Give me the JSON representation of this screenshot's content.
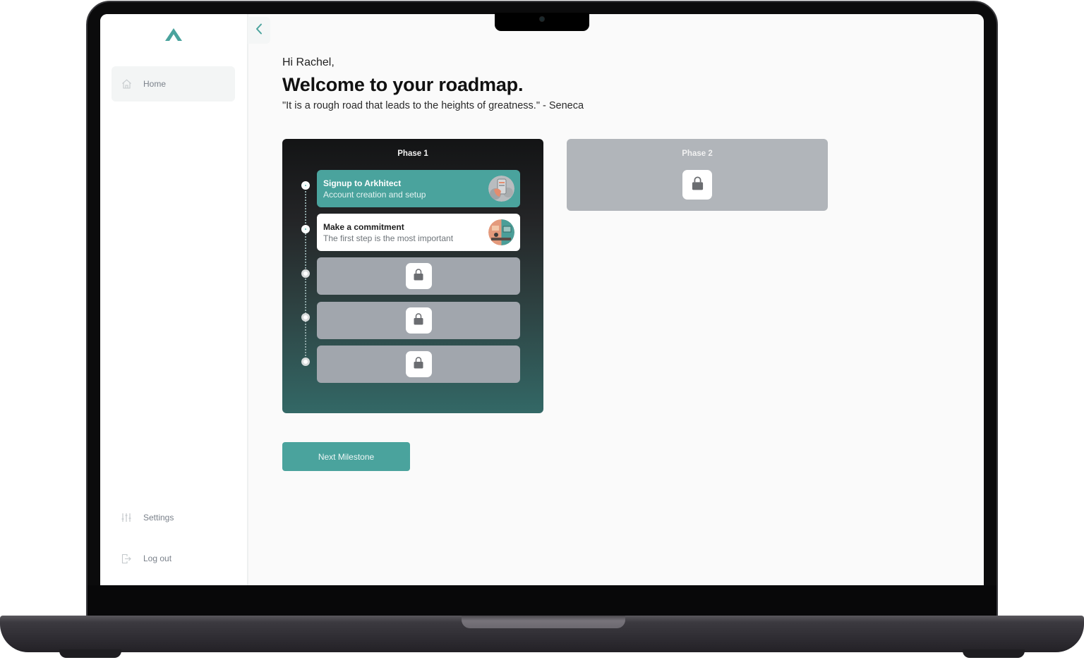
{
  "app": {
    "brand_color": "#4aa39d",
    "logo_icon": "chevron-up-logo"
  },
  "sidebar": {
    "items": [
      {
        "label": "Home",
        "icon": "home-icon",
        "active": true
      },
      {
        "label": "Settings",
        "icon": "sliders-icon",
        "active": false
      },
      {
        "label": "Log out",
        "icon": "logout-icon",
        "active": false
      }
    ],
    "collapse_icon": "chevron-left-icon"
  },
  "main": {
    "greeting": "Hi Rachel,",
    "title": "Welcome to your roadmap.",
    "quote": "\"It is a rough road that leads to the heights of greatness.\" - Seneca",
    "phases": [
      {
        "title": "Phase 1",
        "steps": [
          {
            "title": "Signup to Arkhitect",
            "description": "Account creation and setup",
            "status": "done"
          },
          {
            "title": "Make a commitment",
            "description": "The first step is the most important",
            "status": "current"
          },
          {
            "status": "locked",
            "icon": "lock-icon"
          },
          {
            "status": "locked",
            "icon": "lock-icon"
          },
          {
            "status": "locked",
            "icon": "lock-icon"
          }
        ]
      },
      {
        "title": "Phase 2",
        "status": "locked",
        "icon": "lock-icon"
      }
    ],
    "next_button": "Next Milestone"
  }
}
